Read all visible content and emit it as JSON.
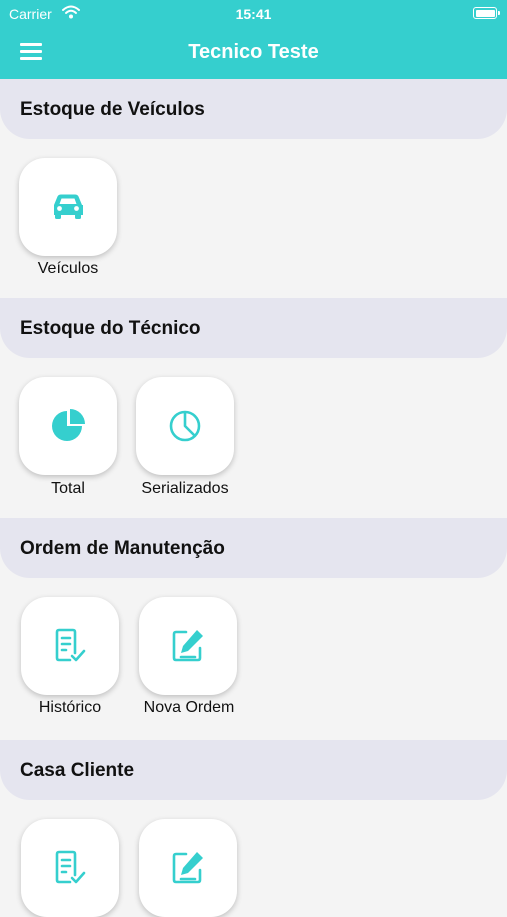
{
  "status_bar": {
    "carrier": "Carrier",
    "time": "15:41"
  },
  "nav": {
    "title": "Tecnico Teste",
    "menu_icon": "hamburger-menu-icon"
  },
  "accent_color": "#35cfce",
  "sections": [
    {
      "title": "Estoque de Veículos",
      "tiles": [
        {
          "label": "Veículos",
          "icon": "car-icon"
        }
      ]
    },
    {
      "title": "Estoque do Técnico",
      "tiles": [
        {
          "label": "Total",
          "icon": "pie-chart-filled-icon"
        },
        {
          "label": "Serializados",
          "icon": "pie-chart-outline-icon"
        }
      ]
    },
    {
      "title": "Ordem de Manutenção",
      "tiles": [
        {
          "label": "Histórico",
          "icon": "checklist-document-icon"
        },
        {
          "label": "Nova Ordem",
          "icon": "edit-document-icon"
        }
      ]
    },
    {
      "title": "Casa Cliente",
      "tiles": [
        {
          "icon": "checklist-document-icon"
        },
        {
          "icon": "edit-document-icon"
        }
      ]
    }
  ]
}
